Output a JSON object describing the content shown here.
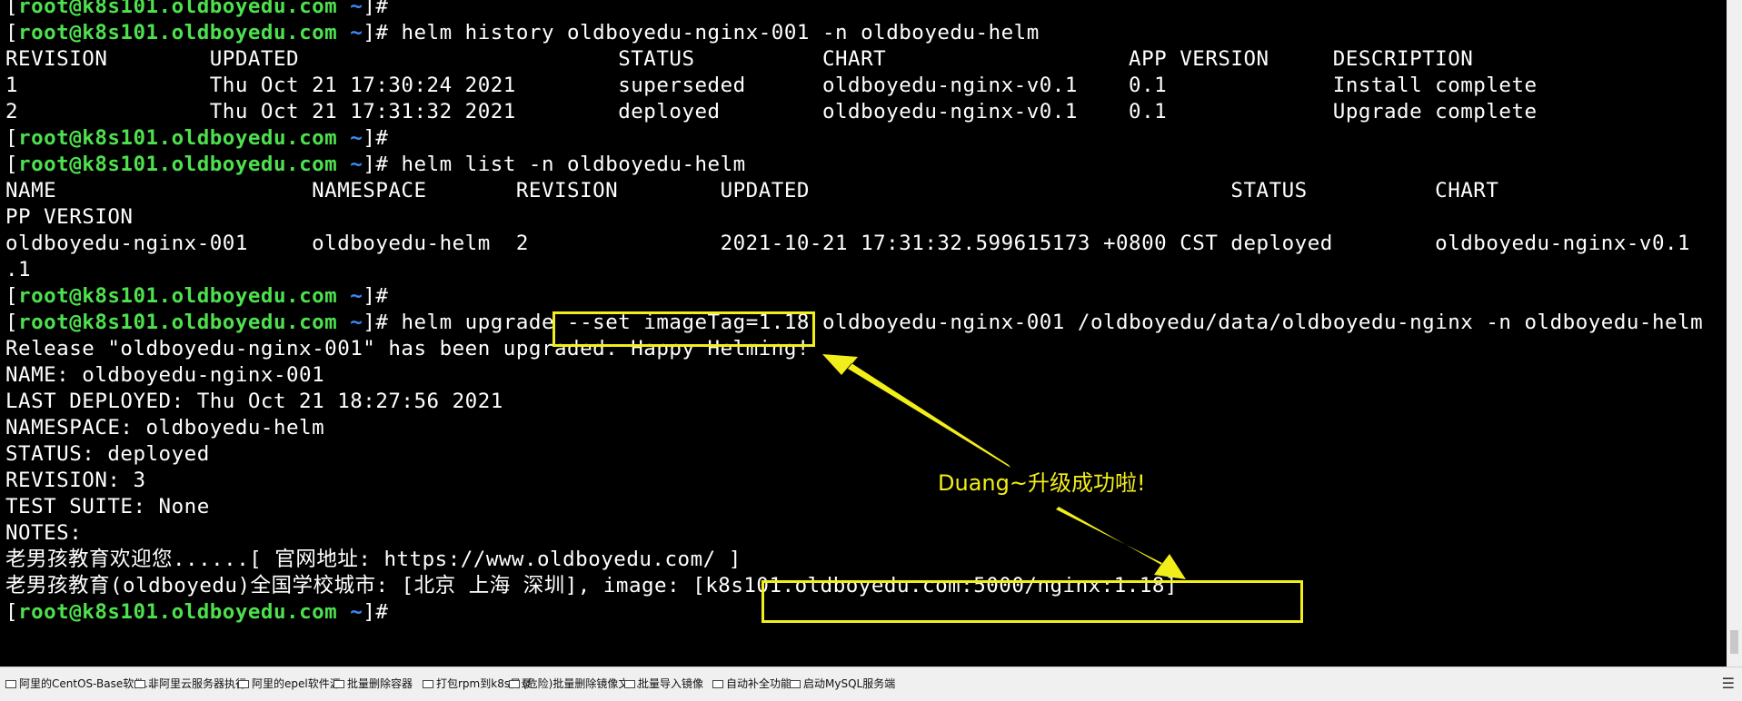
{
  "prompt": {
    "lb": "[",
    "user": "root",
    "at": "@",
    "host": "k8s101.oldboyedu.com",
    "path": " ~",
    "rb": "]",
    "sym": "#"
  },
  "lines": [
    {
      "cmd": ""
    },
    {
      "cmd": " helm history oldboyedu-nginx-001 -n oldboyedu-helm"
    },
    {
      "text": "REVISION        UPDATED                         STATUS          CHART                   APP VERSION     DESCRIPTION"
    },
    {
      "text": "1               Thu Oct 21 17:30:24 2021        superseded      oldboyedu-nginx-v0.1    0.1             Install complete"
    },
    {
      "text": "2               Thu Oct 21 17:31:32 2021        deployed        oldboyedu-nginx-v0.1    0.1             Upgrade complete"
    },
    {
      "cmd": ""
    },
    {
      "cmd": " helm list -n oldboyedu-helm"
    },
    {
      "text": "NAME                    NAMESPACE       REVISION        UPDATED                                 STATUS          CHART                   A"
    },
    {
      "text": "PP VERSION"
    },
    {
      "text": "oldboyedu-nginx-001     oldboyedu-helm  2               2021-10-21 17:31:32.599615173 +0800 CST deployed        oldboyedu-nginx-v0.1    0"
    },
    {
      "text": ".1"
    },
    {
      "cmd": ""
    },
    {
      "cmd": " helm upgrade --set imageTag=1.18 oldboyedu-nginx-001 /oldboyedu/data/oldboyedu-nginx -n oldboyedu-helm"
    },
    {
      "text": "Release \"oldboyedu-nginx-001\" has been upgraded. Happy Helming!"
    },
    {
      "text": "NAME: oldboyedu-nginx-001"
    },
    {
      "text": "LAST DEPLOYED: Thu Oct 21 18:27:56 2021"
    },
    {
      "text": "NAMESPACE: oldboyedu-helm"
    },
    {
      "text": "STATUS: deployed"
    },
    {
      "text": "REVISION: 3"
    },
    {
      "text": "TEST SUITE: None"
    },
    {
      "text": "NOTES:"
    },
    {
      "text": "老男孩教育欢迎您......[ 官网地址: https://www.oldboyedu.com/ ]"
    },
    {
      "text": "老男孩教育(oldboyedu)全国学校城市: [北京 上海 深圳], image: [k8s101.oldboyedu.com:5000/nginx:1.18]"
    },
    {
      "cmd": ""
    }
  ],
  "annotation": {
    "text": "Duang~升级成功啦!",
    "color": "#f2ee1a"
  },
  "quick_commands": [
    "阿里的CentOS-Base软件...",
    "非阿里云服务器执行",
    "阿里的epel软件源",
    "批量删除容器",
    "打包rpm到k8s目录",
    "(危险)批量删除镜像文...",
    "批量导入镜像",
    "自动补全功能",
    "启动MySQL服务端"
  ]
}
